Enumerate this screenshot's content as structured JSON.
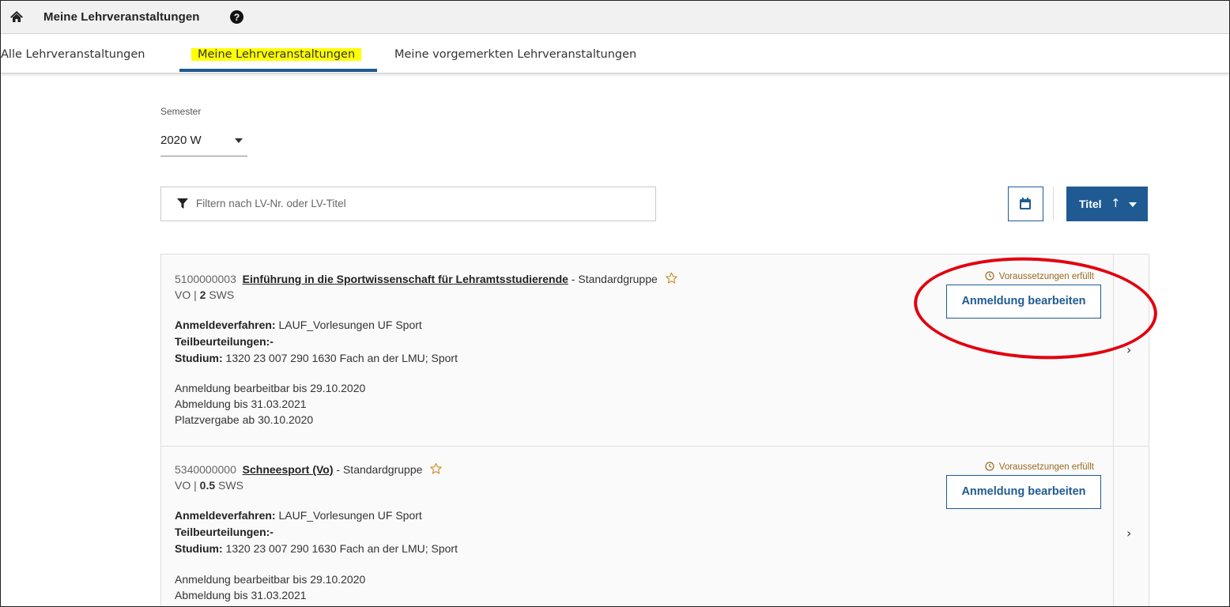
{
  "header": {
    "title": "Meine Lehrveranstaltungen",
    "icons": {
      "home": "home-icon",
      "help": "question-circle-icon"
    }
  },
  "tabs": [
    {
      "label": "Alle Lehrveranstaltungen",
      "active": false
    },
    {
      "label": "Meine Lehrveranstaltungen",
      "active": true,
      "highlighted": true
    },
    {
      "label": "Meine vorgemerkten Lehrveranstaltungen",
      "active": false
    }
  ],
  "semester": {
    "label": "Semester",
    "value": "2020 W"
  },
  "filter": {
    "placeholder": "Filtern nach LV-Nr. oder LV-Titel",
    "icon": "filter-icon"
  },
  "sort": {
    "label": "Titel",
    "direction_symbol": "↑"
  },
  "courses": [
    {
      "number": "5100000003",
      "title": "Einführung in die Sportwissenschaft für Lehramtsstudierende",
      "group": "- Standardgruppe",
      "type": "VO |",
      "sws_value": "2",
      "sws_unit": "SWS",
      "procedure_label": "Anmeldeverfahren:",
      "procedure_value": "LAUF_Vorlesungen UF Sport",
      "partial_label": "Teilbeurteilungen:-",
      "study_label": "Studium:",
      "study_value": "1320 23 007 290 1630 Fach an der LMU; Sport",
      "deadline_edit": "Anmeldung bearbeitbar bis 29.10.2020",
      "deadline_deregister": "Abmeldung bis 31.03.2021",
      "allocation": "Platzvergabe ab 30.10.2020",
      "prerequisite": "Voraussetzungen erfüllt",
      "action": "Anmeldung bearbeiten"
    },
    {
      "number": "5340000000",
      "title": "Schneesport (Vo)",
      "group": "- Standardgruppe",
      "type": "VO |",
      "sws_value": "0.5",
      "sws_unit": "SWS",
      "procedure_label": "Anmeldeverfahren:",
      "procedure_value": "LAUF_Vorlesungen UF Sport",
      "partial_label": "Teilbeurteilungen:-",
      "study_label": "Studium:",
      "study_value": "1320 23 007 290 1630 Fach an der LMU; Sport",
      "deadline_edit": "Anmeldung bearbeitbar bis 29.10.2020",
      "deadline_deregister": "Abmeldung bis 31.03.2021",
      "prerequisite": "Voraussetzungen erfüllt",
      "action": "Anmeldung bearbeiten"
    }
  ],
  "colors": {
    "primary": "#1f5b92",
    "highlight": "#ffff00",
    "prerequisite_text": "#9a6c22",
    "annotation_circle": "#e1000f",
    "star": "#c98a1a"
  }
}
